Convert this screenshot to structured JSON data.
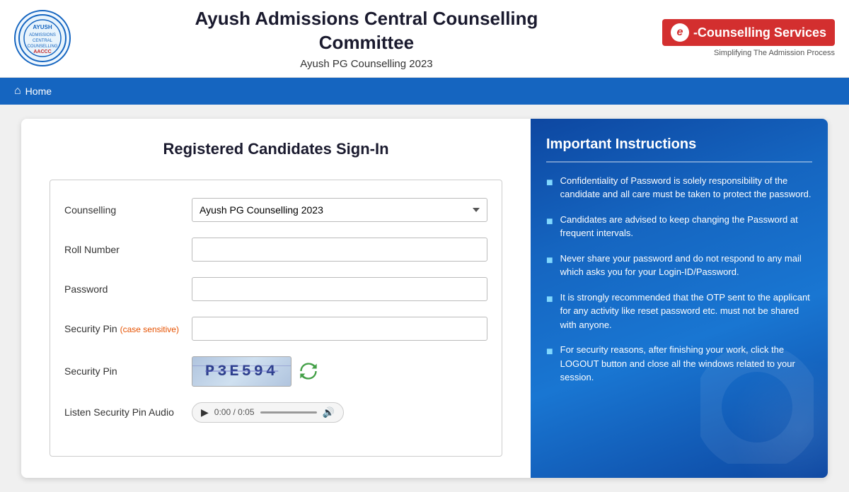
{
  "header": {
    "title_line1": "Ayush Admissions Central Counselling",
    "title_line2": "Committee",
    "subtitle": "Ayush PG Counselling 2023",
    "logo_alt": "AACCC",
    "ecounselling_label": "-Counselling Services",
    "ecounselling_tagline": "Simplifying The Admission Process"
  },
  "navbar": {
    "home_label": "Home"
  },
  "form": {
    "title": "Registered Candidates Sign-In",
    "counselling_label": "Counselling",
    "counselling_value": "Ayush PG Counselling 2023",
    "counselling_options": [
      "Ayush PG Counselling 2023"
    ],
    "roll_number_label": "Roll Number",
    "roll_number_placeholder": "",
    "password_label": "Password",
    "password_placeholder": "",
    "security_pin_input_label": "Security Pin",
    "case_sensitive_note": "(case sensitive)",
    "security_pin_captcha_label": "Security Pin",
    "captcha_text": "P3E594",
    "listen_label": "Listen Security Pin Audio",
    "audio_time": "0:00 / 0:05"
  },
  "instructions": {
    "title": "Important Instructions",
    "items": [
      "Confidentiality of Password is solely responsibility of the candidate and all care must be taken to protect the password.",
      "Candidates are advised to keep changing the Password at frequent intervals.",
      "Never share your password and do not respond to any mail which asks you for your Login-ID/Password.",
      "It is strongly recommended that the OTP sent to the applicant for any activity like reset password etc. must not be shared with anyone.",
      "For security reasons, after finishing your work, click the LOGOUT button and close all the windows related to your session."
    ]
  }
}
